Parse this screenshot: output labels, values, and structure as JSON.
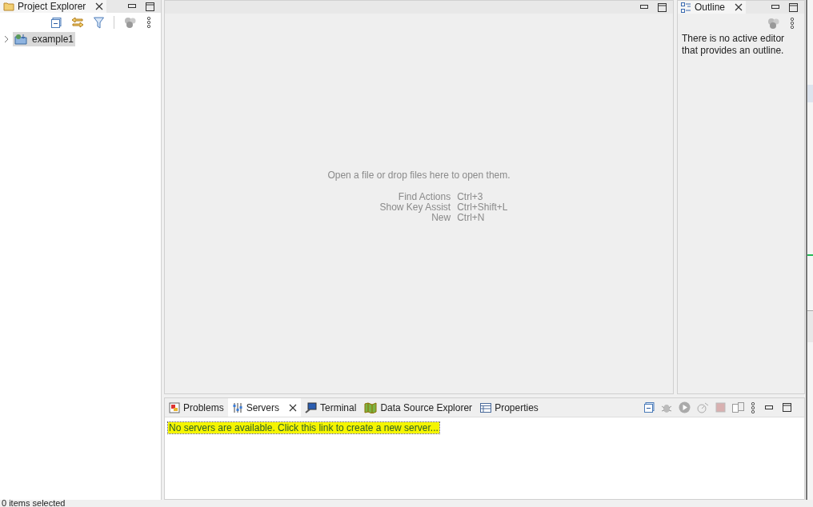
{
  "project_explorer": {
    "title": "Project Explorer",
    "tree": [
      {
        "label": "example1",
        "selected": true,
        "expanded": false
      }
    ]
  },
  "editor_area": {
    "message": "Open a file or drop files here to open them.",
    "shortcuts": [
      {
        "action": "Find Actions",
        "keys": "Ctrl+3"
      },
      {
        "action": "Show Key Assist",
        "keys": "Ctrl+Shift+L"
      },
      {
        "action": "New",
        "keys": "Ctrl+N"
      }
    ]
  },
  "outline": {
    "title": "Outline",
    "message": "There is no active editor that provides an outline."
  },
  "bottom_panel": {
    "tabs": [
      {
        "label": "Problems",
        "selected": false,
        "kind": "problems"
      },
      {
        "label": "Servers",
        "selected": true,
        "kind": "servers"
      },
      {
        "label": "Terminal",
        "selected": false,
        "kind": "terminal"
      },
      {
        "label": "Data Source Explorer",
        "selected": false,
        "kind": "datasource"
      },
      {
        "label": "Properties",
        "selected": false,
        "kind": "properties"
      }
    ],
    "link": "No servers are available. Click this link to create a new server..."
  },
  "status_bar": {
    "text": "0 items selected"
  }
}
